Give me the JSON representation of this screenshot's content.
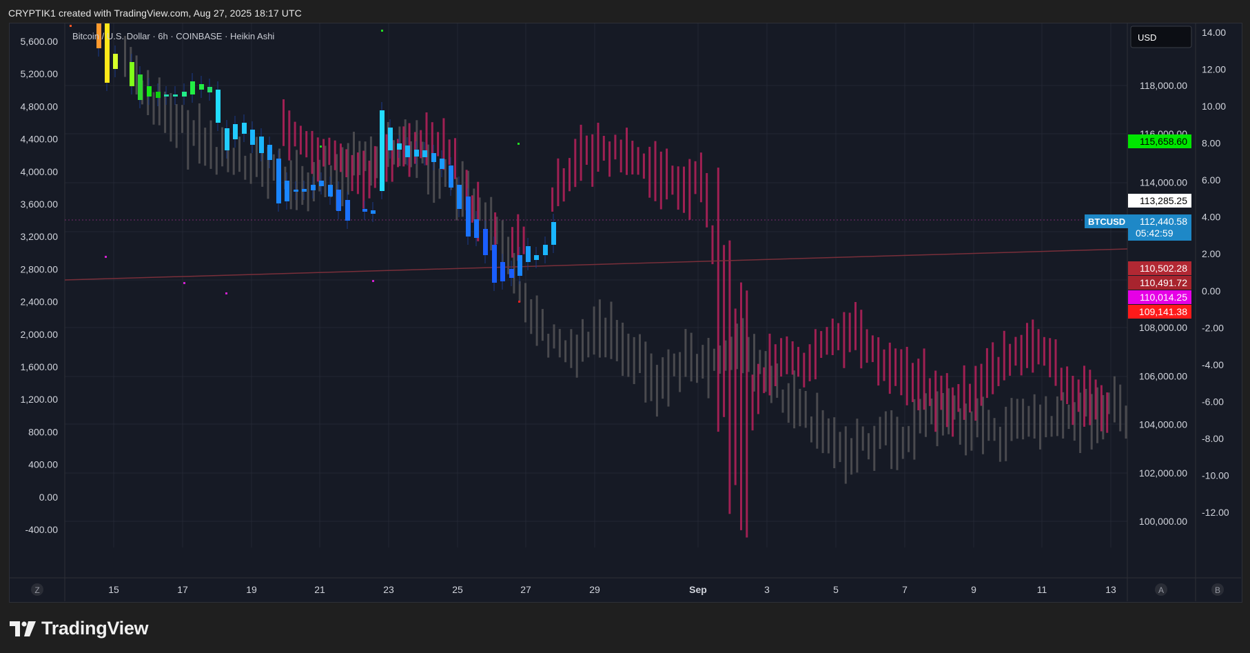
{
  "header": {
    "attribution": "CRYPTIK1 created with TradingView.com, Aug 27, 2025 18:17 UTC"
  },
  "legend": {
    "title": "Bitcoin / U.S. Dollar · 6h · COINBASE · Heikin Ashi"
  },
  "currency_button": {
    "label": "USD"
  },
  "symbol_tag": {
    "label": "BTCUSD"
  },
  "left_axis": {
    "ticks": [
      "5,600.00",
      "5,200.00",
      "4,800.00",
      "4,400.00",
      "4,000.00",
      "3,600.00",
      "3,200.00",
      "2,800.00",
      "2,400.00",
      "2,000.00",
      "1,600.00",
      "1,200.00",
      "800.00",
      "400.00",
      "0.00",
      "-400.00"
    ]
  },
  "right_axis_price": {
    "ticks": [
      "118,000.00",
      "116,000.00",
      "114,000.00",
      "108,000.00",
      "106,000.00",
      "104,000.00",
      "102,000.00",
      "100,000.00"
    ]
  },
  "right_axis_osc": {
    "ticks": [
      "14.00",
      "12.00",
      "10.00",
      "8.00",
      "6.00",
      "4.00",
      "2.00",
      "0.00",
      "-2.00",
      "-4.00",
      "-6.00",
      "-8.00",
      "-10.00",
      "-12.00"
    ]
  },
  "price_labels": [
    {
      "value": "115,658.60",
      "bg": "#00e600",
      "fg": "#000000"
    },
    {
      "value": "113,285.25",
      "bg": "#ffffff",
      "fg": "#000000"
    },
    {
      "value": "112,440.58",
      "sub": "05:42:59",
      "bg": "#1e88c7",
      "fg": "#ffffff"
    },
    {
      "value": "110,502.28",
      "bg": "#b22833",
      "fg": "#ffffff"
    },
    {
      "value": "110,491.72",
      "bg": "#a8242e",
      "fg": "#ffffff"
    },
    {
      "value": "110,014.25",
      "bg": "#e600e6",
      "fg": "#ffffff"
    },
    {
      "value": "109,141.38",
      "bg": "#ff1a1a",
      "fg": "#ffffff"
    }
  ],
  "time_axis": {
    "labels": [
      "15",
      "17",
      "19",
      "21",
      "23",
      "25",
      "27",
      "29",
      "Sep",
      "3",
      "5",
      "7",
      "9",
      "11",
      "13"
    ]
  },
  "bottom_buttons": {
    "left": "Z",
    "right_a": "A",
    "right_b": "B"
  },
  "brand": {
    "name": "TradingView"
  },
  "colors": {
    "background": "#161a25",
    "grid": "#232733",
    "projection": "#b8225c",
    "ghost": "#4a4a4e",
    "trendline": "#7a2f3a"
  },
  "chart_data": {
    "type": "candlestick",
    "title": "Bitcoin / U.S. Dollar · 6h · COINBASE · Heikin Ashi",
    "y_axis_price": {
      "ticks": [
        100000,
        102000,
        104000,
        106000,
        108000,
        114000,
        116000,
        118000
      ]
    },
    "y_axis_oscillator": {
      "min": -12,
      "max": 14
    },
    "x_axis": [
      "15",
      "17",
      "19",
      "21",
      "23",
      "25",
      "27",
      "29",
      "Sep",
      "3",
      "5",
      "7",
      "9",
      "11",
      "13"
    ],
    "last_price": 112440.58,
    "countdown": "05:42:59",
    "horizontal_levels": [
      115658.6,
      113285.25,
      110502.28,
      110491.72,
      110014.25,
      109141.38
    ],
    "grid": true
  }
}
